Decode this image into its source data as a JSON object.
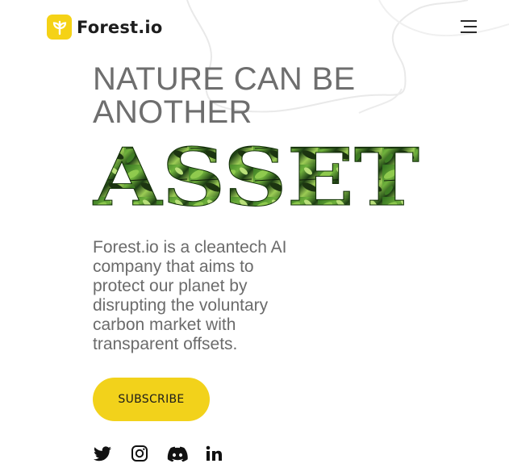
{
  "brand": {
    "name": "Forest.io",
    "accent_color": "#f5d216"
  },
  "header": {
    "menu_icon": "hamburger-menu-icon"
  },
  "hero": {
    "headline": "NATURE CAN BE ANOTHER",
    "highlight_word": "ASSET",
    "description": "Forest.io is a cleantech AI company that aims to protect our planet by disrupting the voluntary carbon market with transparent offsets.",
    "subscribe_label": "SUBSCRIBE"
  },
  "socials": [
    {
      "icon": "twitter-icon"
    },
    {
      "icon": "instagram-icon"
    },
    {
      "icon": "discord-icon"
    },
    {
      "icon": "linkedin-icon"
    }
  ]
}
